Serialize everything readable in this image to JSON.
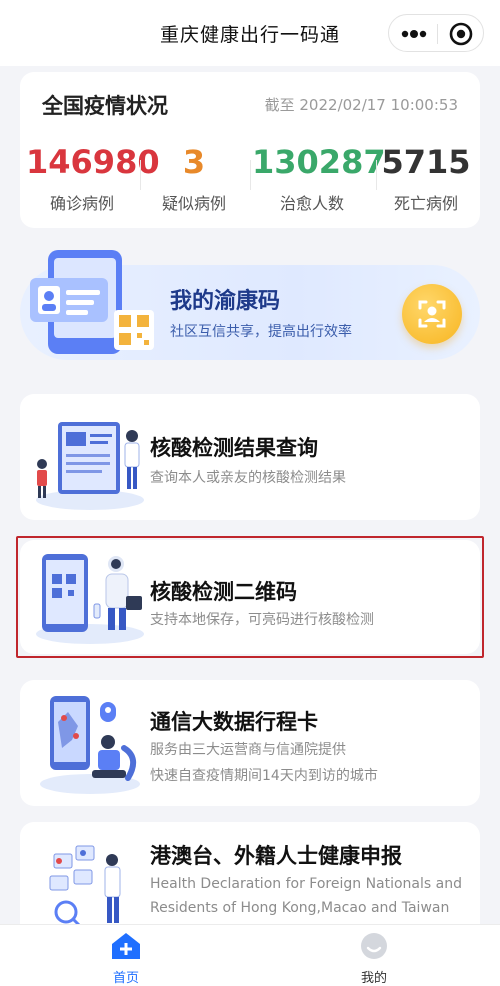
{
  "header": {
    "title": "重庆健康出行一码通",
    "more_icon": "more-dots-icon",
    "close_icon": "target-icon"
  },
  "stats": {
    "title": "全国疫情状况",
    "updated_at": "截至 2022/02/17 10:00:53",
    "items": [
      {
        "value": "146980",
        "label": "确诊病例",
        "color": "#d9363e"
      },
      {
        "value": "3",
        "label": "疑似病例",
        "color": "#e8892a"
      },
      {
        "value": "130287",
        "label": "治愈人数",
        "color": "#3aa86a"
      },
      {
        "value": "5715",
        "label": "死亡病例",
        "color": "#333333"
      }
    ]
  },
  "health_code": {
    "title": "我的渝康码",
    "subtitle": "社区互信共享，提高出行效率",
    "icon": "scan-face-icon"
  },
  "services": [
    {
      "title": "核酸检测结果查询",
      "subtitle": [
        "查询本人或亲友的核酸检测结果"
      ]
    },
    {
      "title": "核酸检测二维码",
      "subtitle": [
        "支持本地保存，可亮码进行核酸检测"
      ]
    },
    {
      "title": "通信大数据行程卡",
      "subtitle": [
        "服务由三大运营商与信通院提供",
        "快速自查疫情期间14天内到访的城市"
      ]
    },
    {
      "title": "港澳台、外籍人士健康申报",
      "subtitle": [
        "Health Declaration for Foreign Nationals and",
        "Residents of Hong Kong,Macao and Taiwan"
      ]
    }
  ],
  "nav": {
    "home": {
      "label": "首页",
      "icon": "home-plus-icon",
      "active": true
    },
    "mine": {
      "label": "我的",
      "icon": "profile-icon",
      "active": false
    }
  },
  "colors": {
    "accent": "#1f6fff",
    "highlight_border": "#c0262d"
  }
}
